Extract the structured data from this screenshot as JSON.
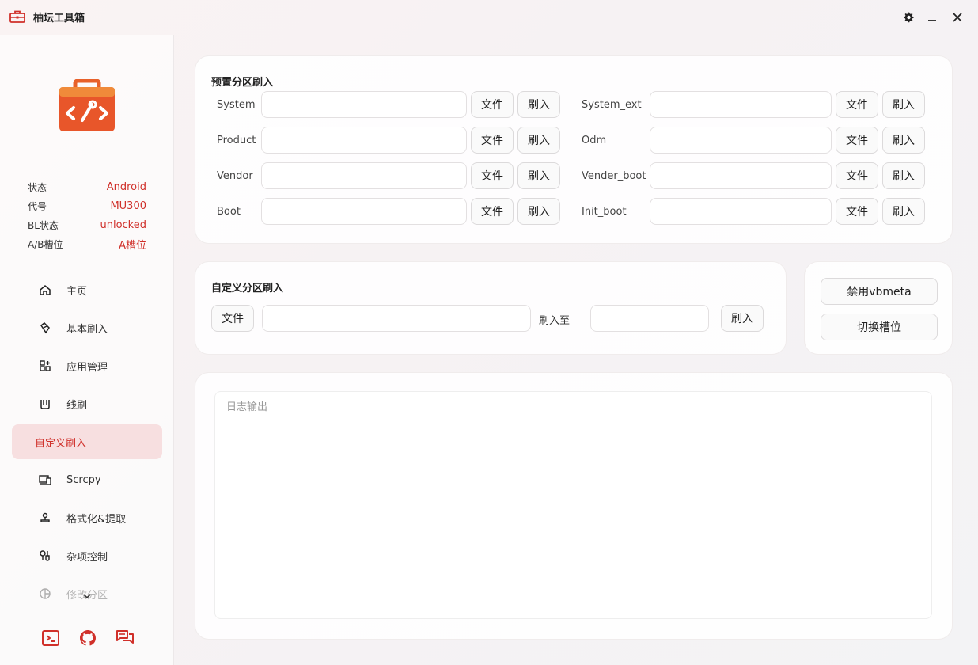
{
  "app": {
    "title": "柚坛工具箱",
    "accent": "#d0302a",
    "icon": "toolbox-icon"
  },
  "window_controls": [
    "gear-icon",
    "minimize-icon",
    "close-icon"
  ],
  "device_info": [
    {
      "label": "状态",
      "value": "Android"
    },
    {
      "label": "代号",
      "value": "MU300"
    },
    {
      "label": "BL状态",
      "value": "unlocked"
    },
    {
      "label": "A/B槽位",
      "value": "A槽位"
    }
  ],
  "nav": [
    {
      "label": "主页",
      "icon": "home-icon"
    },
    {
      "label": "基本刷入",
      "icon": "flash-icon"
    },
    {
      "label": "应用管理",
      "icon": "apps-icon"
    },
    {
      "label": "线刷",
      "icon": "cable-icon"
    },
    {
      "label": "自定义刷入",
      "icon": "",
      "active": true
    },
    {
      "label": "Scrcpy",
      "icon": "devices-icon"
    },
    {
      "label": "格式化&提取",
      "icon": "stamp-icon"
    },
    {
      "label": "杂项控制",
      "icon": "tools-icon"
    },
    {
      "label": "修改分区",
      "icon": "pie-icon"
    }
  ],
  "bottom_icons": [
    "terminal-icon",
    "github-icon",
    "chat-icon"
  ],
  "preset": {
    "title": "预置分区刷入",
    "file_label": "文件",
    "flash_label": "刷入",
    "left": [
      "System",
      "Product",
      "Vendor",
      "Boot"
    ],
    "right": [
      "System_ext",
      "Odm",
      "Vender_boot",
      "Init_boot"
    ]
  },
  "custom": {
    "title": "自定义分区刷入",
    "file_label": "文件",
    "flash_to_label": "刷入至",
    "flash_label": "刷入"
  },
  "actions": {
    "disable_vbmeta": "禁用vbmeta",
    "switch_slot": "切换槽位"
  },
  "log": {
    "placeholder": "日志输出"
  }
}
